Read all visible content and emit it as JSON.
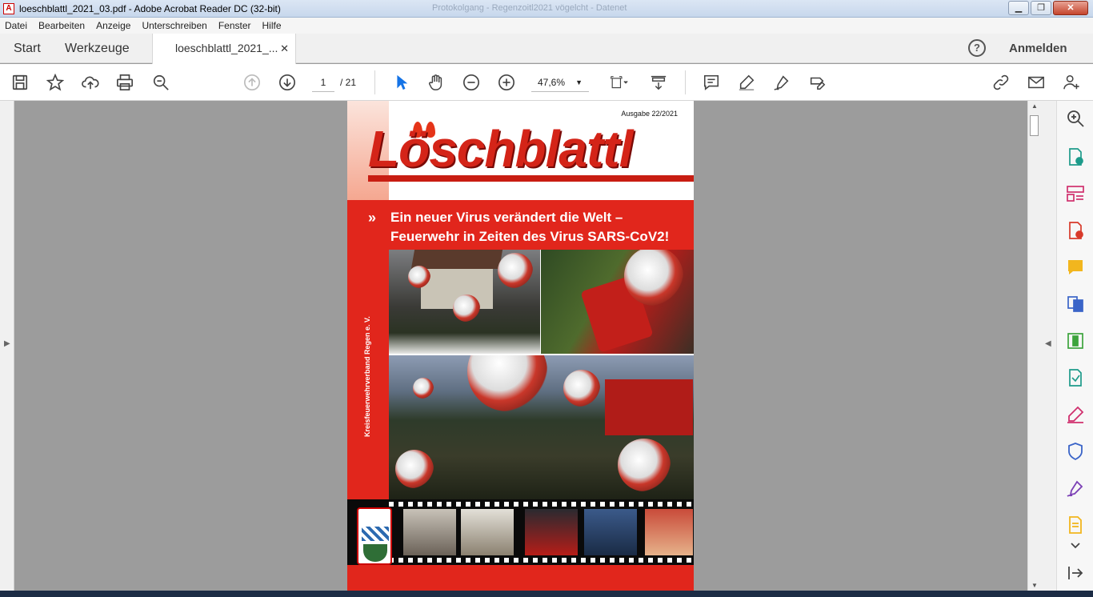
{
  "window": {
    "title": "loeschblattl_2021_03.pdf - Adobe Acrobat Reader DC (32-bit)",
    "ghost_title": "Protokolgang - Regenzoitl2021 vögelcht - Datenet",
    "minimize": "▁",
    "maximize": "❐",
    "close": "✕"
  },
  "menu": [
    "Datei",
    "Bearbeiten",
    "Anzeige",
    "Unterschreiben",
    "Fenster",
    "Hilfe"
  ],
  "tabs": {
    "start": "Start",
    "tools": "Werkzeuge",
    "document": "loeschblattl_2021_...",
    "close_glyph": "✕"
  },
  "header": {
    "help": "?",
    "signin": "Anmelden"
  },
  "toolbar": {
    "page_current": "1",
    "page_total": "/ 21",
    "zoom": "47,6%",
    "zoom_caret": "▼"
  },
  "document": {
    "issue": "Ausgabe 22/2021",
    "masthead": "Löschblattl",
    "bullet": "»",
    "headline_line1": "Ein neuer Virus verändert die Welt –",
    "headline_line2": "Feuerwehr in Zeiten des Virus SARS-CoV2!",
    "vertical_text": "Kreisfeuerwehrverband Regen e. V."
  },
  "panels": {
    "left_arrow": "▶",
    "right_arrow": "◀",
    "scroll_up": "▲",
    "scroll_down": "▼"
  },
  "colors": {
    "accent_red": "#e1261c",
    "acrobat_blue": "#1473e6"
  }
}
